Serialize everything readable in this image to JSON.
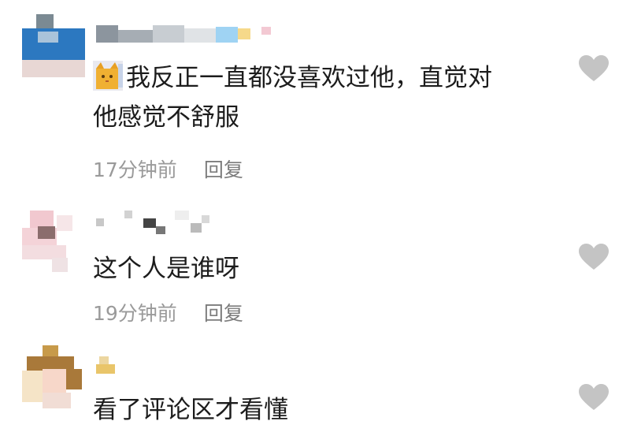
{
  "comments": [
    {
      "text_line1": "我反正一直都没喜欢过他，直觉对",
      "text_line2": "他感觉不舒服",
      "emoji": "cat-emoji",
      "time": "17分钟前",
      "reply": "回复"
    },
    {
      "text": "这个人是谁呀",
      "time": "19分钟前",
      "reply": "回复"
    },
    {
      "text": "看了评论区才看懂"
    }
  ],
  "colors": {
    "text": "#1c1c1c",
    "meta": "#9a9a9a",
    "heart": "#c4c4c4"
  },
  "icons": [
    "heart-icon",
    "cat-emoji"
  ]
}
